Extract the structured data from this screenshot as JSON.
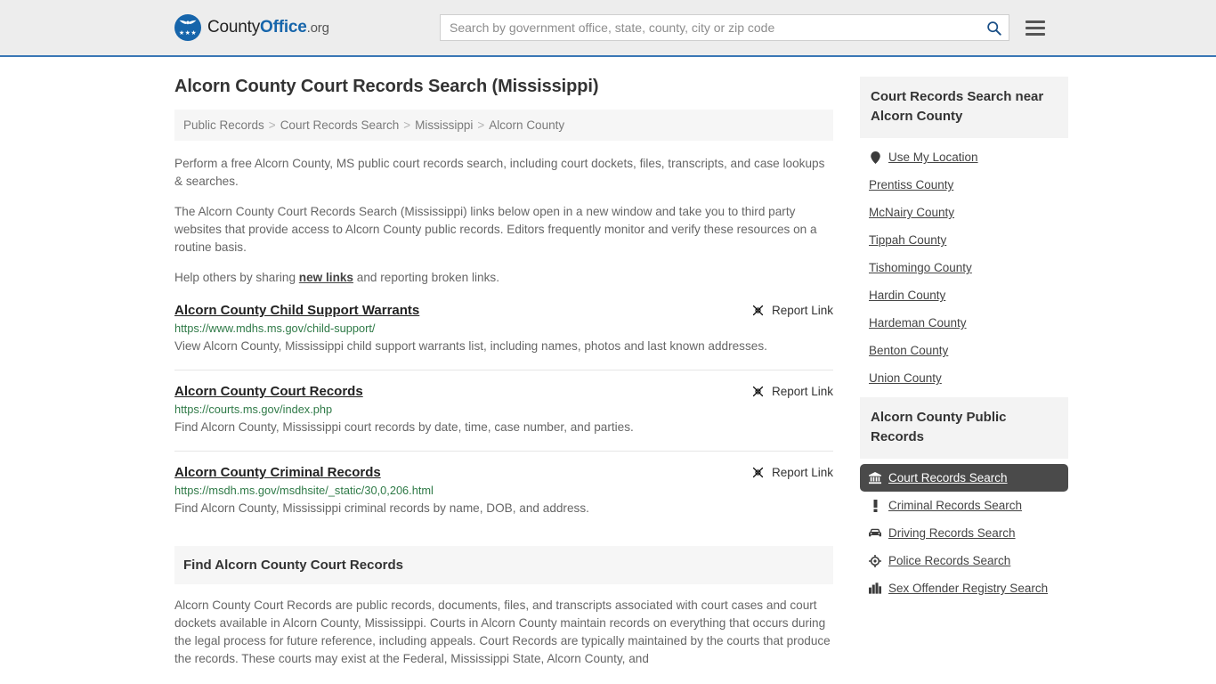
{
  "header": {
    "logo": {
      "text_county": "County",
      "text_office": "Office",
      "text_org": ".org",
      "stars": "★★★"
    },
    "search": {
      "placeholder": "Search by government office, state, county, city or zip code",
      "value": ""
    },
    "search_icon": "search-icon",
    "menu_icon": "hamburger-menu-icon"
  },
  "main": {
    "title": "Alcorn County Court Records Search (Mississippi)",
    "breadcrumb": [
      "Public Records",
      "Court Records Search",
      "Mississippi",
      "Alcorn County"
    ],
    "breadcrumb_separator": ">",
    "intro": {
      "p1": "Perform a free Alcorn County, MS public court records search, including court dockets, files, transcripts, and case lookups & searches.",
      "p2": "The Alcorn County Court Records Search (Mississippi) links below open in a new window and take you to third party websites that provide access to Alcorn County public records. Editors frequently monitor and verify these resources on a routine basis.",
      "p3_before": "Help others by sharing ",
      "p3_link": "new links",
      "p3_after": " and reporting broken links."
    },
    "report_link_label": "Report Link",
    "results": [
      {
        "title": "Alcorn County Child Support Warrants",
        "url": "https://www.mdhs.ms.gov/child-support/",
        "description": "View Alcorn County, Mississippi child support warrants list, including names, photos and last known addresses."
      },
      {
        "title": "Alcorn County Court Records",
        "url": "https://courts.ms.gov/index.php",
        "description": "Find Alcorn County, Mississippi court records by date, time, case number, and parties."
      },
      {
        "title": "Alcorn County Criminal Records",
        "url": "https://msdh.ms.gov/msdhsite/_static/30,0,206.html",
        "description": "Find Alcorn County, Mississippi criminal records by name, DOB, and address."
      }
    ],
    "find_section": {
      "heading": "Find Alcorn County Court Records",
      "body": "Alcorn County Court Records are public records, documents, files, and transcripts associated with court cases and court dockets available in Alcorn County, Mississippi. Courts in Alcorn County maintain records on everything that occurs during the legal process for future reference, including appeals. Court Records are typically maintained by the courts that produce the records. These courts may exist at the Federal, Mississippi State, Alcorn County, and"
    }
  },
  "sidebar": {
    "nearby": {
      "heading": "Court Records Search near Alcorn County",
      "items": [
        {
          "label": "Use My Location",
          "icon": "map-pin-icon"
        },
        {
          "label": "Prentiss County",
          "icon": ""
        },
        {
          "label": "McNairy County",
          "icon": ""
        },
        {
          "label": "Tippah County",
          "icon": ""
        },
        {
          "label": "Tishomingo County",
          "icon": ""
        },
        {
          "label": "Hardin County",
          "icon": ""
        },
        {
          "label": "Hardeman County",
          "icon": ""
        },
        {
          "label": "Benton County",
          "icon": ""
        },
        {
          "label": "Union County",
          "icon": ""
        }
      ]
    },
    "public_records": {
      "heading": "Alcorn County Public Records",
      "items": [
        {
          "label": "Court Records Search",
          "icon": "bank-icon",
          "active": true
        },
        {
          "label": "Criminal Records Search",
          "icon": "exclamation-icon",
          "active": false
        },
        {
          "label": "Driving Records Search",
          "icon": "car-icon",
          "active": false
        },
        {
          "label": "Police Records Search",
          "icon": "target-icon",
          "active": false
        },
        {
          "label": "Sex Offender Registry Search",
          "icon": "buildings-icon",
          "active": false
        }
      ]
    }
  },
  "colors": {
    "brand_blue": "#1665ab",
    "header_bg": "#ededed",
    "header_border": "#3a77b5",
    "url_green": "#2f7a47",
    "active_bg": "#4a4a4a",
    "panel_bg": "#f3f3f3"
  }
}
